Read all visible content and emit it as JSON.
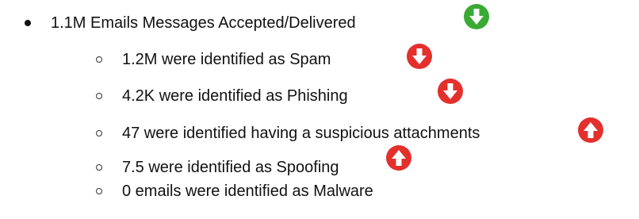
{
  "items": [
    {
      "text": "1.1M Emails Messages Accepted/Delivered",
      "icon": "down-arrow-icon",
      "color": "#3aaa35"
    },
    {
      "text": "1.2M were identified as Spam",
      "icon": "down-arrow-icon",
      "color": "#e3302d"
    },
    {
      "text": "4.2K were identified as Phishing",
      "icon": "down-arrow-icon",
      "color": "#e3302d"
    },
    {
      "text": "47 were identified having a suspicious attachments",
      "icon": "up-arrow-icon",
      "color": "#e3302d"
    },
    {
      "text": "7.5 were identified as Spoofing",
      "icon": "up-arrow-icon",
      "color": "#e3302d"
    },
    {
      "text": "0 emails were identified as Malware"
    }
  ]
}
